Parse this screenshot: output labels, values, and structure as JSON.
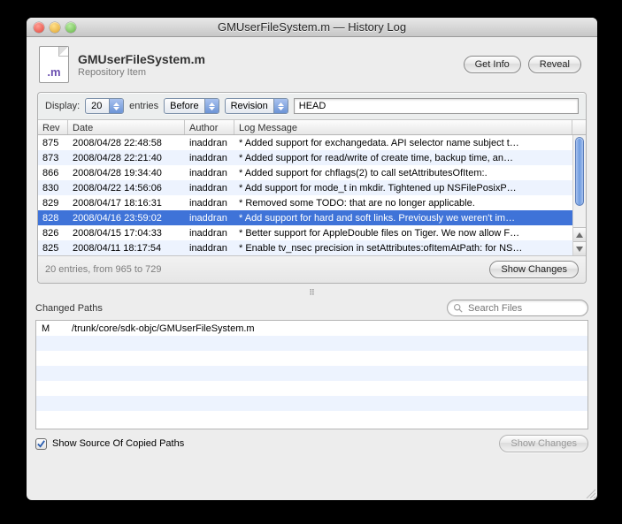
{
  "window": {
    "title": "GMUserFileSystem.m — History Log"
  },
  "header": {
    "icon_ext": ".m",
    "file_name": "GMUserFileSystem.m",
    "subtitle": "Repository Item",
    "get_info": "Get Info",
    "reveal": "Reveal"
  },
  "filter": {
    "display_label": "Display:",
    "count": "20",
    "entries_label": "entries",
    "direction": "Before",
    "mode": "Revision",
    "revision_value": "HEAD"
  },
  "log_table": {
    "columns": {
      "rev": "Rev",
      "date": "Date",
      "author": "Author",
      "msg": "Log Message"
    },
    "rows": [
      {
        "rev": "875",
        "date": "2008/04/28 22:48:58",
        "author": "inaddran",
        "msg": "* Added support for exchangedata. API selector name subject t…"
      },
      {
        "rev": "873",
        "date": "2008/04/28 22:21:40",
        "author": "inaddran",
        "msg": "* Added support for read/write of create time, backup time, an…"
      },
      {
        "rev": "866",
        "date": "2008/04/28 19:34:40",
        "author": "inaddran",
        "msg": "* Added support for chflags(2) to call setAttributesOfItem:."
      },
      {
        "rev": "830",
        "date": "2008/04/22 14:56:06",
        "author": "inaddran",
        "msg": "* Add support for mode_t in mkdir. Tightened up NSFilePosixP…"
      },
      {
        "rev": "829",
        "date": "2008/04/17 18:16:31",
        "author": "inaddran",
        "msg": "* Removed some TODO: that are no longer applicable."
      },
      {
        "rev": "828",
        "date": "2008/04/16 23:59:02",
        "author": "inaddran",
        "msg": "* Add support for hard and soft links. Previously we weren't im…",
        "selected": true
      },
      {
        "rev": "826",
        "date": "2008/04/15 17:04:33",
        "author": "inaddran",
        "msg": "* Better support for AppleDouble files on Tiger. We now allow F…"
      },
      {
        "rev": "825",
        "date": "2008/04/11 18:17:54",
        "author": "inaddran",
        "msg": "* Enable tv_nsec precision in setAttributes:ofItemAtPath: for NS…"
      }
    ],
    "footer_info": "20 entries, from 965 to 729",
    "show_changes": "Show Changes"
  },
  "paths": {
    "title": "Changed Paths",
    "search_placeholder": "Search Files",
    "rows": [
      {
        "status": "M",
        "path": "/trunk/core/sdk-objc/GMUserFileSystem.m"
      }
    ],
    "show_copied_label": "Show Source Of Copied Paths",
    "show_copied_checked": true,
    "show_changes": "Show Changes"
  }
}
